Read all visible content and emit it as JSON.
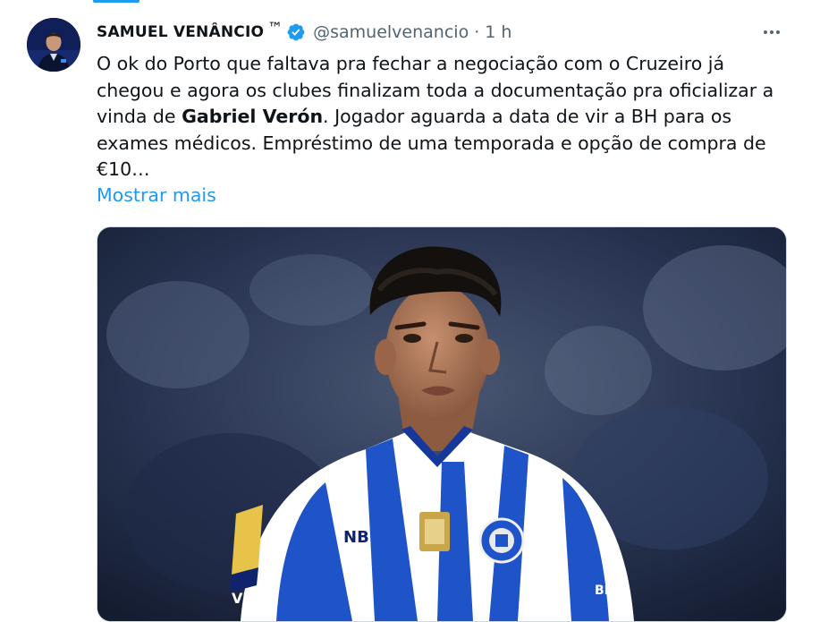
{
  "tweet": {
    "author": {
      "display_name": "SAMUEL VENÂNCIO",
      "trademark": "™",
      "handle": "@samuelvenancio",
      "verified": true,
      "avatar_icon": "user-avatar"
    },
    "separator": "·",
    "time": "1 h",
    "more_icon": "more-horizontal-icon",
    "text_parts": {
      "p1": "O ok do Porto que faltava pra fechar a negociação com o Cruzeiro já chegou e agora os clubes finalizam toda a documentação pra oficializar a vinda de ",
      "bold": "Gabriel Verón",
      "p2": ". Jogador aguarda a data de vir a BH para os exames médicos. Empréstimo de uma temporada e opção de compra de €10…"
    },
    "show_more_label": "Mostrar mais",
    "media": {
      "description_icon": "player-photo",
      "jersey_sponsor": "NB",
      "jersey_sleeve": "VIN",
      "jersey_sleeve_right": "BIN"
    }
  },
  "colors": {
    "accent": "#1d9bf0",
    "text": "#0f1419",
    "secondary": "#536471",
    "porto_blue": "#1f54c8"
  }
}
